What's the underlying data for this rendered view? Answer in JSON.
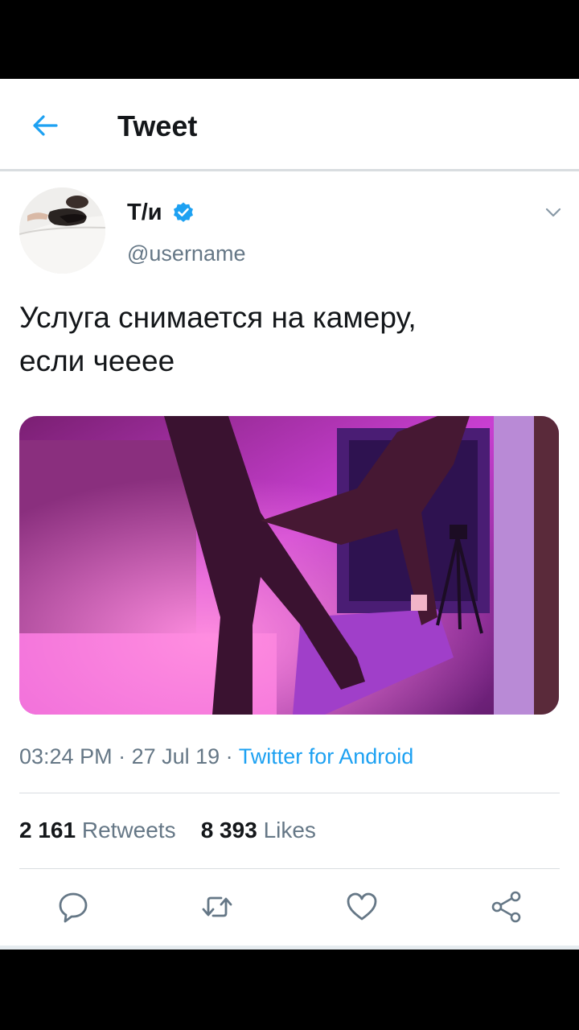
{
  "header": {
    "title": "Tweet",
    "back_icon": "arrow-left-icon",
    "accent": "#1da1f2"
  },
  "author": {
    "display_name": "Т/и",
    "handle": "@username",
    "verified": true,
    "avatar_icon": "avatar-photo"
  },
  "tweet": {
    "text_line1": "Услуга снимается на камеру,",
    "text_line2": "если чееее",
    "time": "03:24 PM",
    "sep1": " · ",
    "date": "27 Jul 19",
    "sep2": " · ",
    "source": "Twitter for Android"
  },
  "stats": {
    "retweets_count": "2 161",
    "retweets_label": "Retweets",
    "likes_count": "8 393",
    "likes_label": "Likes"
  },
  "actions": [
    "reply-icon",
    "retweet-icon",
    "like-icon",
    "share-icon"
  ]
}
